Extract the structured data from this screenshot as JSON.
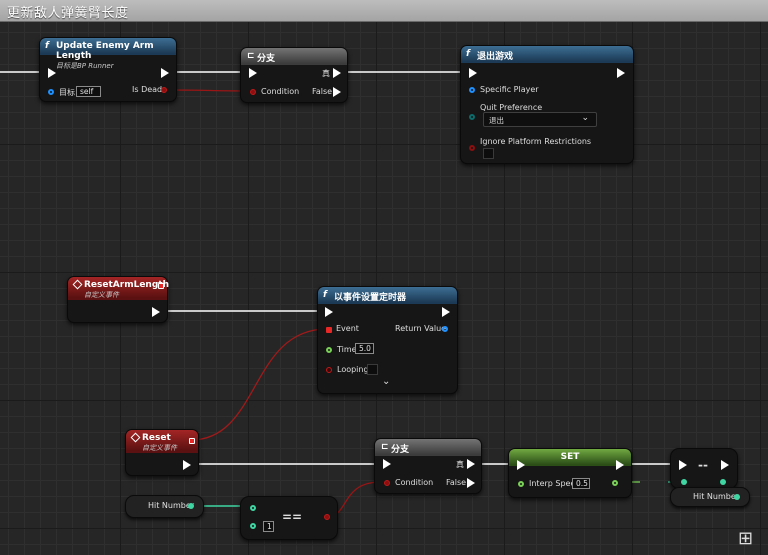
{
  "window": {
    "title": "更新敌人弹簧臂长度"
  },
  "nodes": {
    "update_arm": {
      "title": "Update Enemy Arm Length",
      "subtitle": "目标是BP Runner",
      "target_label": "目标",
      "target_value": "self",
      "out_label": "Is Dead"
    },
    "branch1": {
      "title": "分支",
      "condition_label": "Condition",
      "true_label": "真",
      "false_label": "False"
    },
    "quit_game": {
      "title": "退出游戏",
      "player_label": "Specific Player",
      "pref_label": "Quit Preference",
      "pref_value": "退出",
      "ignore_label": "Ignore Platform Restrictions"
    },
    "reset_arm_event": {
      "title": "ResetArmLength",
      "subtitle": "自定义事件"
    },
    "timer": {
      "title": "以事件设置定时器",
      "event_label": "Event",
      "return_label": "Return Value",
      "time_label": "Time",
      "time_value": "5.0",
      "looping_label": "Looping"
    },
    "reset_event": {
      "title": "Reset",
      "subtitle": "自定义事件"
    },
    "branch2": {
      "title": "分支",
      "condition_label": "Condition",
      "true_label": "真",
      "false_label": "False"
    },
    "set_node": {
      "title": "SET",
      "interp_label": "Interp Speed",
      "interp_value": "0.5"
    },
    "decrement": {
      "symbol": "--",
      "var_label": "Hit Number"
    },
    "hit_number_get": {
      "label": "Hit Number"
    },
    "equals": {
      "symbol": "==",
      "b_value": "1"
    }
  },
  "colors": {
    "exec": "#ffffff",
    "bool": "#8c1010",
    "int": "#3fd6a4",
    "float": "#7ad157",
    "object": "#1e90ff",
    "event": "#e82727"
  },
  "icons": [
    "function-icon",
    "branch-icon",
    "event-icon",
    "exec-pin-icon",
    "chevron-down-icon",
    "reroute-icon"
  ]
}
